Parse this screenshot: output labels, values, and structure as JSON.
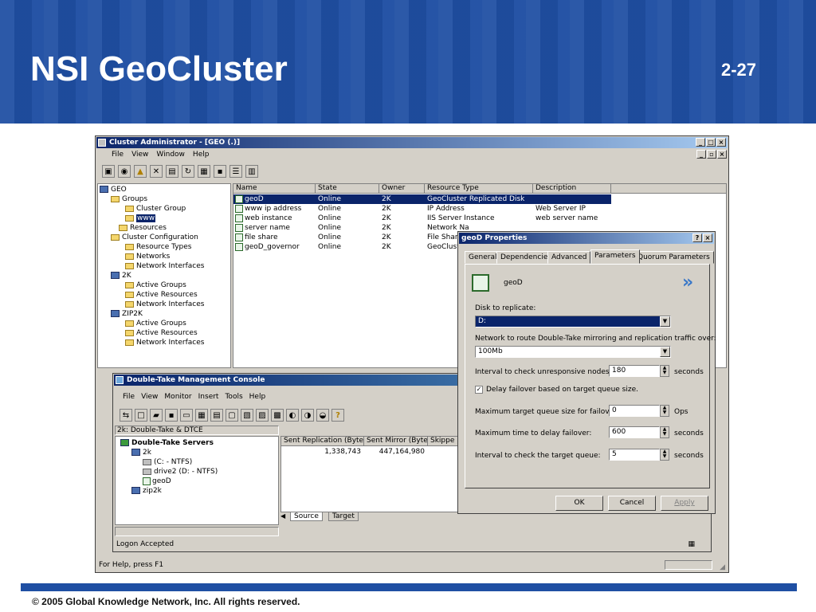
{
  "slide": {
    "title": "NSI GeoCluster",
    "page_number": "2-27",
    "copyright": "© 2005 Global Knowledge Network, Inc. All rights reserved."
  },
  "cluster_admin": {
    "title": "Cluster Administrator - [GEO (.)]",
    "menu": [
      "File",
      "View",
      "Window",
      "Help"
    ],
    "tree": [
      {
        "label": "GEO",
        "type": "node"
      },
      {
        "label": "Groups",
        "type": "folder"
      },
      {
        "label": "Cluster Group",
        "type": "folder"
      },
      {
        "label": "www",
        "type": "folder",
        "selected": true
      },
      {
        "label": "Resources",
        "type": "folder"
      },
      {
        "label": "Cluster Configuration",
        "type": "folder"
      },
      {
        "label": "Resource Types",
        "type": "folder"
      },
      {
        "label": "Networks",
        "type": "folder"
      },
      {
        "label": "Network Interfaces",
        "type": "folder"
      },
      {
        "label": "2K",
        "type": "node"
      },
      {
        "label": "Active Groups",
        "type": "folder"
      },
      {
        "label": "Active Resources",
        "type": "folder"
      },
      {
        "label": "Network Interfaces",
        "type": "folder"
      },
      {
        "label": "ZIP2K",
        "type": "node"
      },
      {
        "label": "Active Groups",
        "type": "folder"
      },
      {
        "label": "Active Resources",
        "type": "folder"
      },
      {
        "label": "Network Interfaces",
        "type": "folder"
      }
    ],
    "columns": [
      "Name",
      "State",
      "Owner",
      "Resource Type",
      "Description"
    ],
    "rows": [
      [
        "geoD",
        "Online",
        "2K",
        "GeoCluster Replicated Disk",
        ""
      ],
      [
        "www ip address",
        "Online",
        "2K",
        "IP Address",
        "Web Server IP"
      ],
      [
        "web instance",
        "Online",
        "2K",
        "IIS Server Instance",
        "web server name"
      ],
      [
        "server name",
        "Online",
        "2K",
        "Network Na",
        ""
      ],
      [
        "file share",
        "Online",
        "2K",
        "File Share",
        ""
      ],
      [
        "geoD_governor",
        "Online",
        "2K",
        "GeoCluster",
        ""
      ]
    ],
    "status": "For Help, press F1"
  },
  "dtmc": {
    "title": "Double-Take Management Console",
    "menu": [
      "File",
      "View",
      "Monitor",
      "Insert",
      "Tools",
      "Help"
    ],
    "address": "2k: Double-Take & DTCE",
    "tree": [
      {
        "label": "Double-Take Servers"
      },
      {
        "label": "2k"
      },
      {
        "label": "(C: - NTFS)"
      },
      {
        "label": "drive2 (D: - NTFS)"
      },
      {
        "label": "geoD"
      },
      {
        "label": "zip2k"
      }
    ],
    "columns": [
      "Sent Replication (Bytes)",
      "Sent Mirror (Bytes)",
      "Skippe"
    ],
    "values": [
      "1,338,743",
      "447,164,980"
    ],
    "tabs": [
      "Source",
      "Target"
    ],
    "status": "Logon Accepted"
  },
  "props": {
    "title": "geoD Properties",
    "tabs": [
      "General",
      "Dependencies",
      "Advanced",
      "Parameters",
      "Quorum Parameters"
    ],
    "resource_name": "geoD",
    "disk_label": "Disk to replicate:",
    "disk_value": "D:",
    "network_label": "Network to route Double-Take mirroring and replication traffic over:",
    "network_value": "100Mb",
    "interval_label": "Interval to check unresponsive nodes:",
    "interval_value": "180",
    "seconds": "seconds",
    "delay_check_label": "Delay failover based on target queue size.",
    "queue_label": "Maximum target queue size for failover:",
    "queue_value": "0",
    "ops": "Ops",
    "maxtime_label": "Maximum time to delay failover:",
    "maxtime_value": "600",
    "check_label": "Interval to check the target queue:",
    "check_value": "5",
    "ok": "OK",
    "cancel": "Cancel",
    "apply": "Apply"
  }
}
